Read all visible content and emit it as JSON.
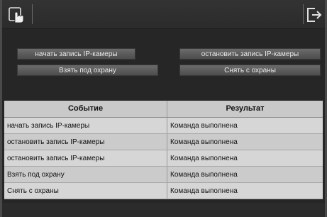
{
  "toolbar": {
    "left_icon": "hand-pointer-icon",
    "right_icon": "exit-icon"
  },
  "buttons": {
    "start_recording": "начать запись IP-камеры",
    "stop_recording": "остановить запись IP-камеры",
    "arm": "Взять под охрану",
    "disarm": "Снять с охраны"
  },
  "table": {
    "headers": {
      "event": "Событие",
      "result": "Результат"
    },
    "rows": [
      {
        "event": "начать запись IP-камеры",
        "result": "Команда выполнена"
      },
      {
        "event": "остановить запись IP-камеры",
        "result": "Команда выполнена"
      },
      {
        "event": "остановить запись IP-камеры",
        "result": "Команда выполнена"
      },
      {
        "event": "Взять под охрану",
        "result": "Команда выполнена"
      },
      {
        "event": "Снять с охраны",
        "result": "Команда выполнена"
      }
    ]
  },
  "colors": {
    "background": "#262626",
    "button": "#5c5c5c",
    "table_row": "#d4d4d4"
  }
}
